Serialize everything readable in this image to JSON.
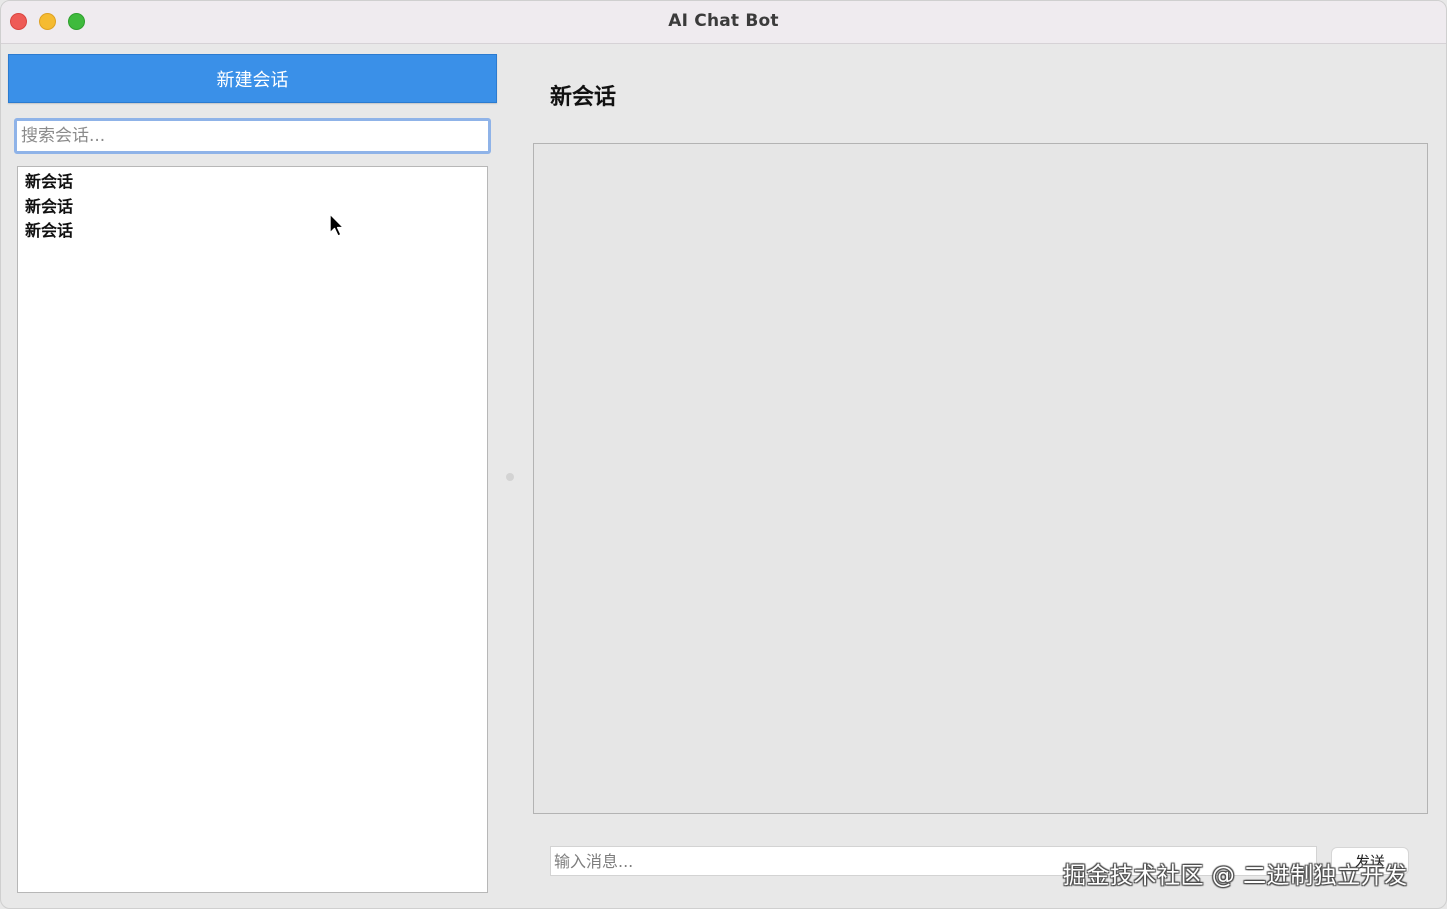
{
  "window": {
    "title": "AI Chat Bot"
  },
  "sidebar": {
    "new_button_label": "新建会话",
    "search_placeholder": "搜索会话...",
    "conversations": [
      {
        "label": "新会话"
      },
      {
        "label": "新会话"
      },
      {
        "label": "新会话"
      }
    ]
  },
  "main": {
    "chat_title": "新会话",
    "message_placeholder": "输入消息...",
    "send_label": "发送"
  },
  "overlay": {
    "watermark": "掘金技术社区 @ 二进制独立开发"
  },
  "colors": {
    "accent": "#3a90e8",
    "traffic_close": "#ee5b56",
    "traffic_minimize": "#f5bb31",
    "traffic_maximize": "#3fba3d"
  }
}
